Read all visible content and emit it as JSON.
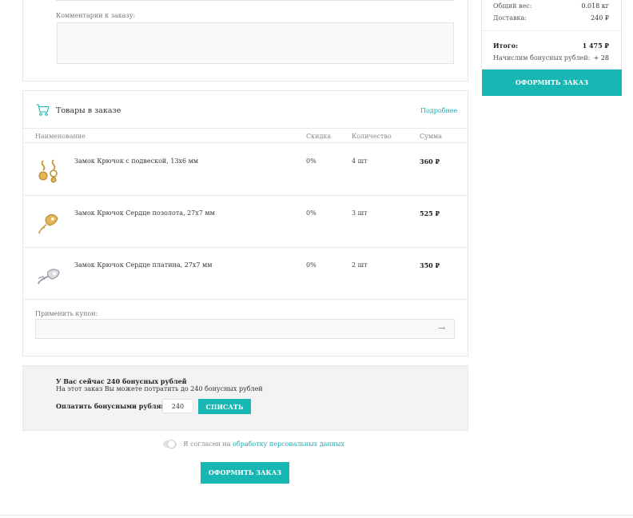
{
  "comment": {
    "label": "Комментарии к заказу:"
  },
  "items": {
    "title": "Товары в заказе",
    "more_link": "Подробнее",
    "columns": {
      "name": "Наименование",
      "discount": "Скидка",
      "quantity": "Количество",
      "sum": "Сумма"
    },
    "rows": [
      {
        "name": "Замок Крючок с подвеской, 13х6 мм",
        "discount": "0%",
        "quantity": "4 шт",
        "sum": "360 ₽"
      },
      {
        "name": "Замок Крючок Сердце позолота, 27х7 мм",
        "discount": "0%",
        "quantity": "3 шт",
        "sum": "525 ₽"
      },
      {
        "name": "Замок Крючок Сердце платина, 27х7 мм",
        "discount": "0%",
        "quantity": "2 шт",
        "sum": "350 ₽"
      }
    ]
  },
  "coupon": {
    "label": "Применить купон:",
    "arrow": "→"
  },
  "bonus": {
    "line1": "У Вас сейчас 240 бонусных рублей",
    "line2": "На этот заказ Вы можете потратить до 240 бонусных рублей",
    "pay_label": "Оплатить бонусными рублями:",
    "input_value": "240",
    "button": "СПИСАТЬ"
  },
  "agreement": {
    "text": "Я согласен на ",
    "link": "обработку персональных данных"
  },
  "order_button": "ОФОРМИТЬ ЗАКАЗ",
  "summary": {
    "weight_label": "Общий вес:",
    "weight_value": "0.018 кг",
    "delivery_label": "Доставка:",
    "delivery_value": "240 ₽",
    "total_label": "Итого:",
    "total_value": "1 475 ₽",
    "bonus_label": "Начислим бонусных рублей:",
    "bonus_value": "+ 28",
    "button": "ОФОРМИТЬ ЗАКАЗ"
  },
  "colors": {
    "accent": "#18b7b3",
    "link": "#1aaab2"
  }
}
